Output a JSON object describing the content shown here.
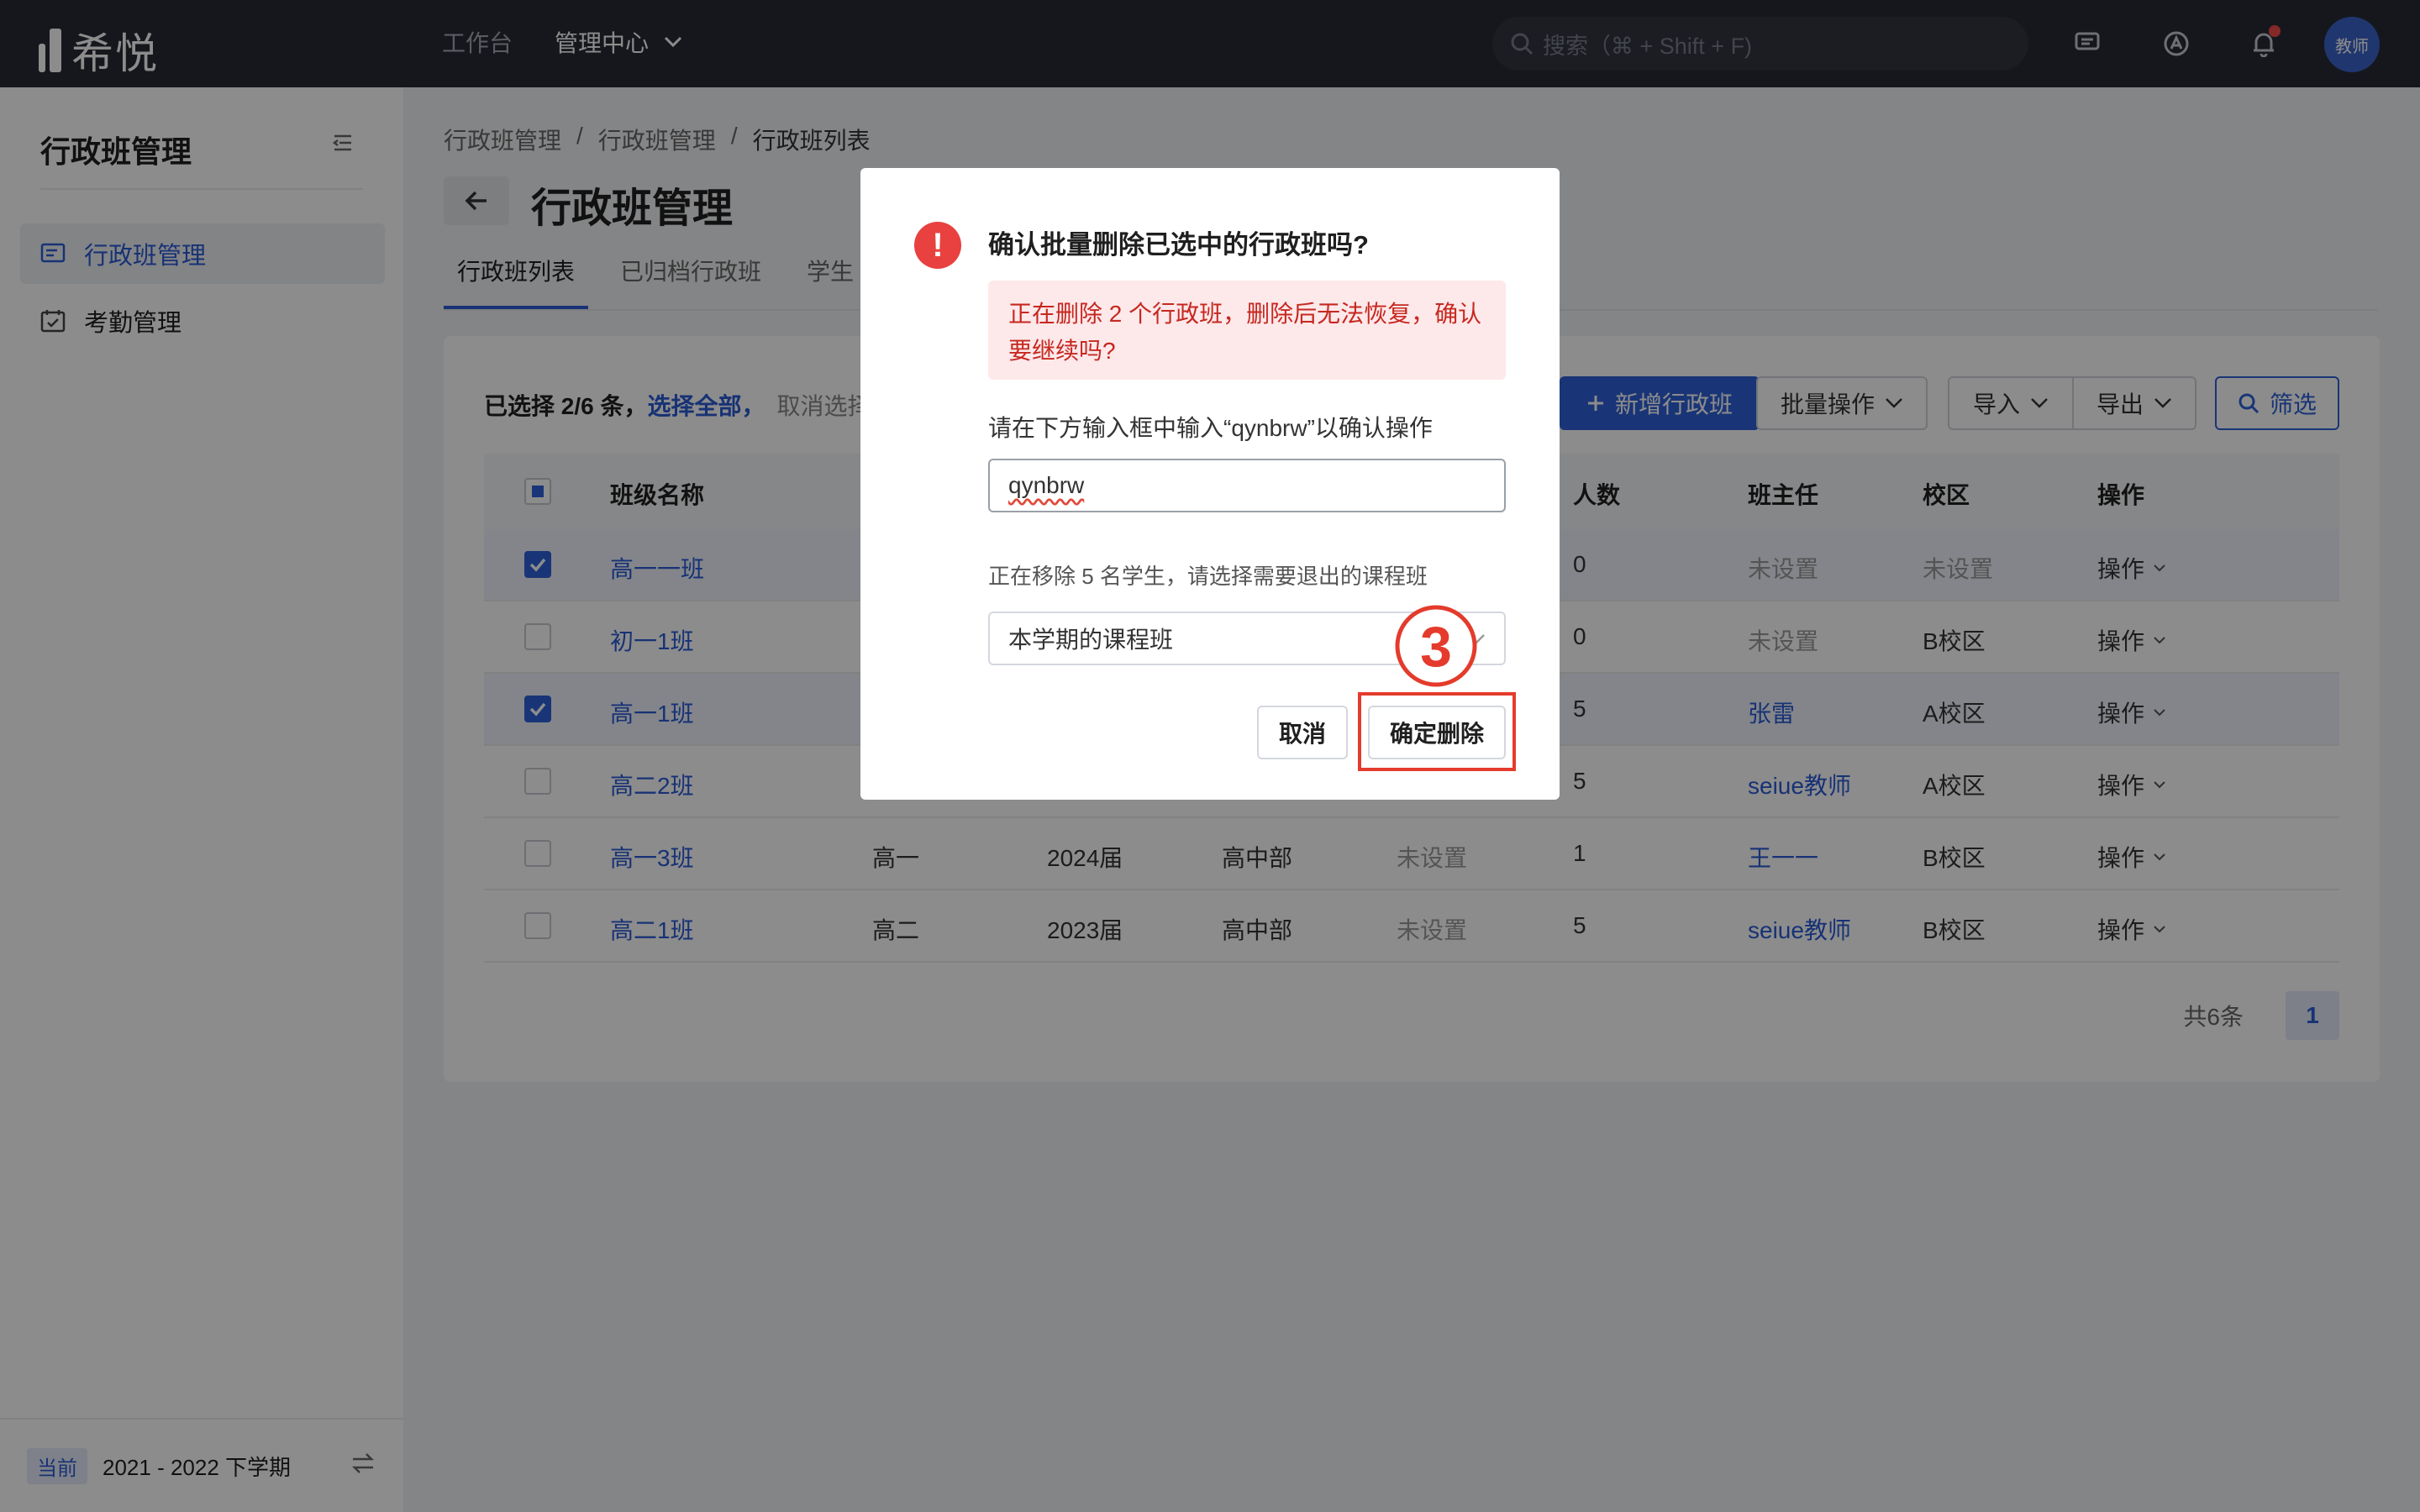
{
  "topbar": {
    "logo_text": "希悦",
    "nav": [
      {
        "label": "工作台"
      },
      {
        "label": "管理中心"
      }
    ],
    "search_placeholder": "搜索（⌘ + Shift + F)",
    "avatar_text": "教师"
  },
  "sidebar": {
    "title": "行政班管理",
    "items": [
      {
        "label": "行政班管理"
      },
      {
        "label": "考勤管理"
      }
    ],
    "footer": {
      "badge": "当前",
      "term": "2021 - 2022 下学期"
    }
  },
  "main": {
    "breadcrumb": [
      "行政班管理",
      "/",
      "行政班管理",
      "/",
      "行政班列表"
    ],
    "title": "行政班管理",
    "tabs": [
      {
        "label": "行政班列表"
      },
      {
        "label": "已归档行政班"
      },
      {
        "label": "学生"
      }
    ],
    "selection": {
      "prefix": "已选择 2/6 条，",
      "select_all": "选择全部，",
      "cancel": "取消选择"
    },
    "buttons": {
      "add": "新增行政班",
      "batch": "批量操作",
      "import": "导入",
      "export": "导出",
      "filter": "筛选"
    },
    "table": {
      "headers": {
        "name": "班级名称",
        "count": "人数",
        "teacher": "班主任",
        "campus": "校区",
        "op": "操作"
      },
      "rows": [
        {
          "name": "高一一班",
          "grade": "",
          "year": "",
          "dept": "",
          "room": "",
          "count": "0",
          "teacher": "未设置",
          "campus": "未设置",
          "op": "操作",
          "checked": true
        },
        {
          "name": "初一1班",
          "grade": "",
          "year": "",
          "dept": "",
          "room": "",
          "count": "0",
          "teacher": "未设置",
          "campus": "B校区",
          "op": "操作",
          "checked": false
        },
        {
          "name": "高一1班",
          "grade": "",
          "year": "",
          "dept": "",
          "room": "",
          "count": "5",
          "teacher": "张雷",
          "campus": "A校区",
          "op": "操作",
          "checked": true
        },
        {
          "name": "高二2班",
          "grade": "",
          "year": "",
          "dept": "",
          "room": "",
          "count": "5",
          "teacher": "seiue教师",
          "campus": "A校区",
          "op": "操作",
          "checked": false
        },
        {
          "name": "高一3班",
          "grade": "高一",
          "year": "2024届",
          "dept": "高中部",
          "room": "未设置",
          "count": "1",
          "teacher": "王一一",
          "campus": "B校区",
          "op": "操作",
          "checked": false
        },
        {
          "name": "高二1班",
          "grade": "高二",
          "year": "2023届",
          "dept": "高中部",
          "room": "未设置",
          "count": "5",
          "teacher": "seiue教师",
          "campus": "B校区",
          "op": "操作",
          "checked": false
        }
      ]
    },
    "pager": {
      "total": "共6条",
      "page": "1"
    }
  },
  "modal": {
    "icon": "!",
    "title": "确认批量删除已选中的行政班吗?",
    "alert": "正在删除 2 个行政班，删除后无法恢复，确认要继续吗?",
    "confirm_label": "请在下方输入框中输入“qynbrw”以确认操作",
    "input_value": "qynbrw",
    "remove_label": "正在移除 5 名学生，请选择需要退出的课程班",
    "select_value": "本学期的课程班",
    "cancel": "取消",
    "ok": "确定删除",
    "step": "3"
  },
  "colors": {
    "accent": "#2e62d9",
    "danger": "#e8413f",
    "annotation": "#e43b2c"
  }
}
